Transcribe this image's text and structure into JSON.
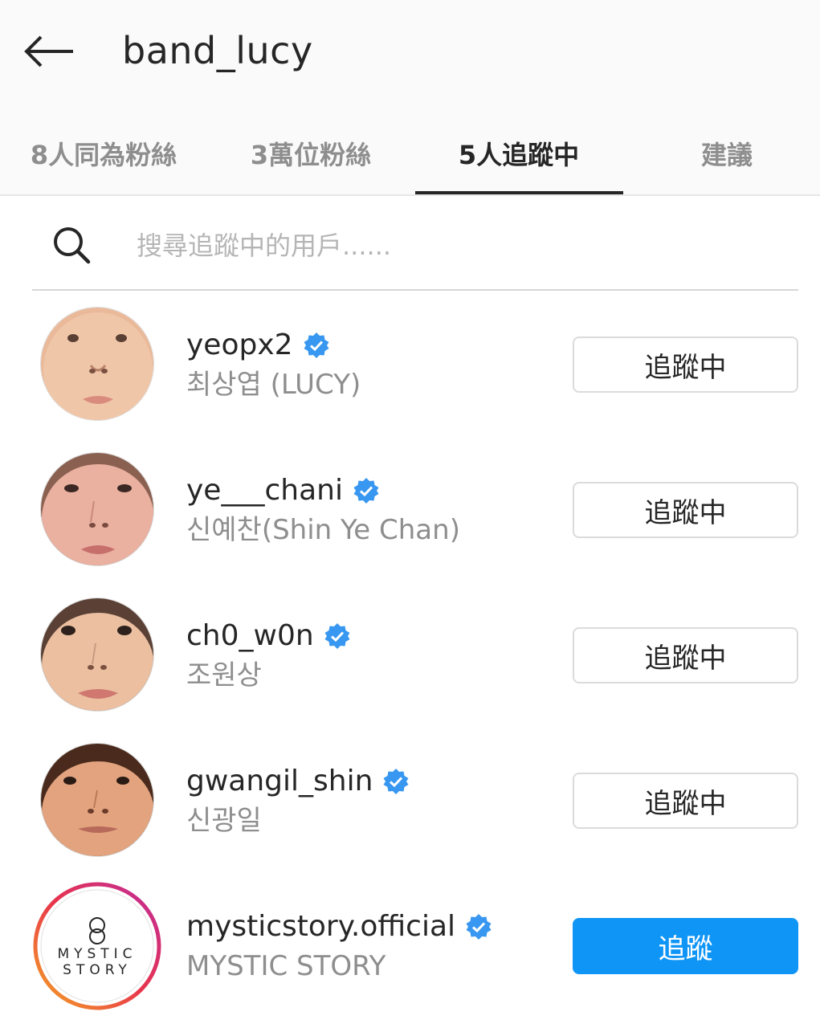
{
  "header": {
    "title": "band_lucy",
    "back_icon": "arrow-left-icon"
  },
  "tabs": [
    {
      "label": "8人同為粉絲",
      "active": false
    },
    {
      "label": "3萬位粉絲",
      "active": false
    },
    {
      "label": "5人追蹤中",
      "active": true
    },
    {
      "label": "建議",
      "active": false
    }
  ],
  "search": {
    "placeholder": "搜尋追蹤中的用戶......",
    "value": "",
    "icon": "search-icon"
  },
  "colors": {
    "accent": "#0f95f6",
    "verified": "#3897f0",
    "muted_text": "#8e8e8e"
  },
  "following": [
    {
      "username": "yeopx2",
      "full_name": "최상엽 (LUCY)",
      "verified": true,
      "button": "追蹤中"
    },
    {
      "username": "ye___chani",
      "full_name": "신예찬(Shin Ye Chan)",
      "verified": true,
      "button": "追蹤中"
    },
    {
      "username": "ch0_w0n",
      "full_name": "조원상",
      "verified": true,
      "button": "追蹤中"
    },
    {
      "username": "gwangil_shin",
      "full_name": "신광일",
      "verified": true,
      "button": "追蹤中"
    },
    {
      "username": "mysticstory.official",
      "full_name": "MYSTIC STORY",
      "verified": true,
      "button": "追蹤",
      "avatar_text": "MYSTIC STORY"
    }
  ]
}
